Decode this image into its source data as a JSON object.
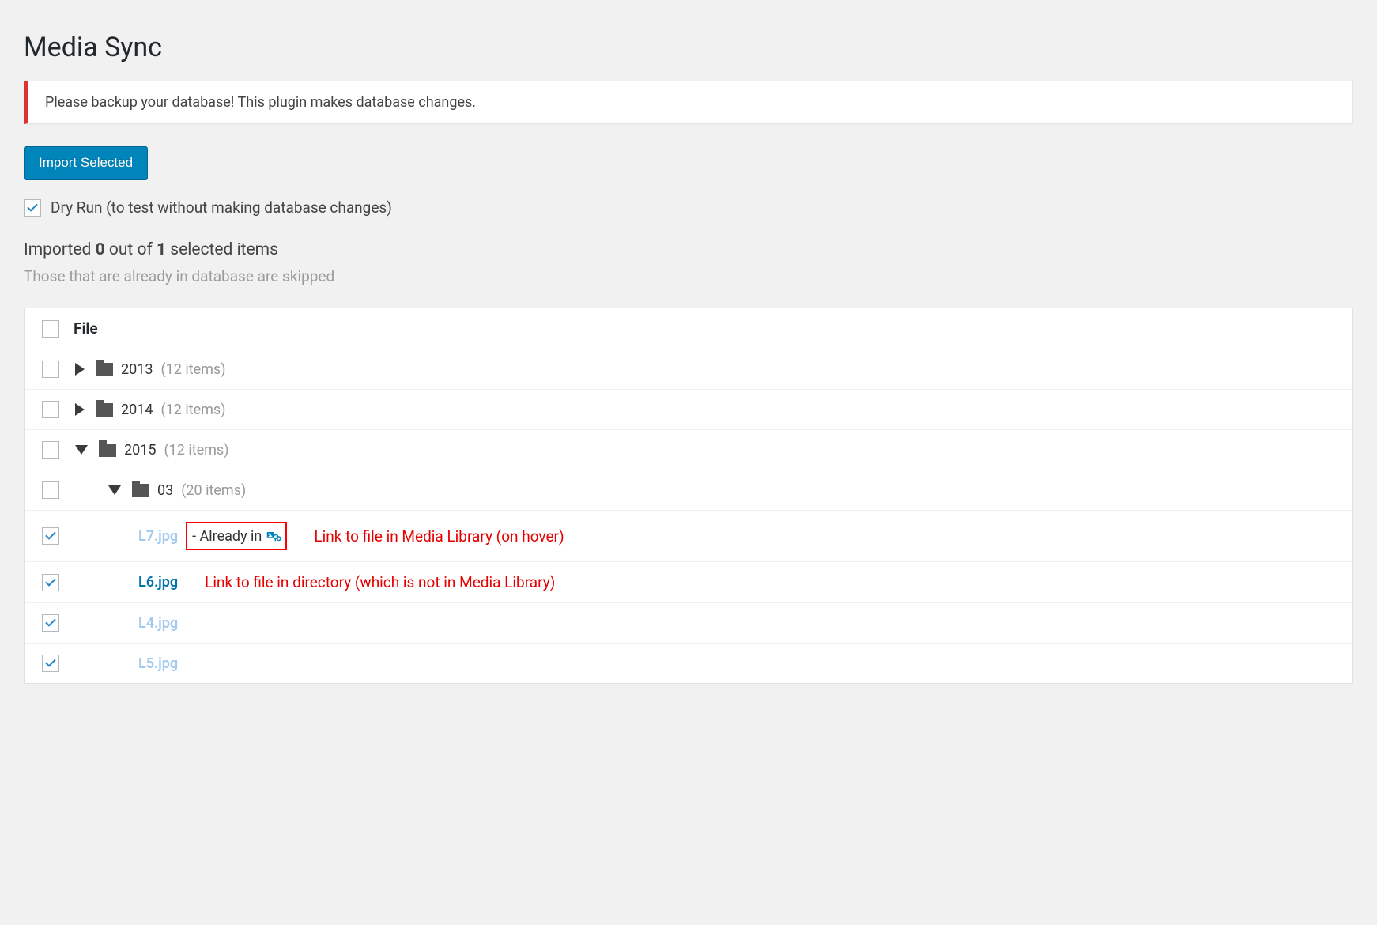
{
  "page": {
    "title": "Media Sync",
    "notice": "Please backup your database! This plugin makes database changes.",
    "import_button": "Import Selected",
    "dry_run_label": "Dry Run (to test without making database changes)",
    "status_prefix": "Imported",
    "status_imported": "0",
    "status_mid": "out of",
    "status_selected": "1",
    "status_suffix": "selected items",
    "substatus": "Those that are already in database are skipped"
  },
  "table": {
    "header_label": "File"
  },
  "rows": [
    {
      "type": "folder",
      "name": "2013",
      "count_label": "(12 items)",
      "expanded": false,
      "indent": 0,
      "checked": false
    },
    {
      "type": "folder",
      "name": "2014",
      "count_label": "(12 items)",
      "expanded": false,
      "indent": 0,
      "checked": false
    },
    {
      "type": "folder",
      "name": "2015",
      "count_label": "(12 items)",
      "expanded": true,
      "indent": 0,
      "checked": false
    },
    {
      "type": "folder",
      "name": "03",
      "count_label": "(20 items)",
      "expanded": true,
      "indent": 1,
      "checked": false
    },
    {
      "type": "file",
      "name": "L7.jpg",
      "indent": 2,
      "checked": true,
      "muted": true,
      "already_in_text": "- Already in",
      "annotation": "Link to file in Media Library (on hover)",
      "highlight_box": true
    },
    {
      "type": "file",
      "name": "L6.jpg",
      "indent": 2,
      "checked": true,
      "muted": false,
      "annotation": "Link to file in directory (which is not in Media Library)"
    },
    {
      "type": "file",
      "name": "L4.jpg",
      "indent": 2,
      "checked": true,
      "muted": true
    },
    {
      "type": "file",
      "name": "L5.jpg",
      "indent": 2,
      "checked": true,
      "muted": true
    }
  ]
}
